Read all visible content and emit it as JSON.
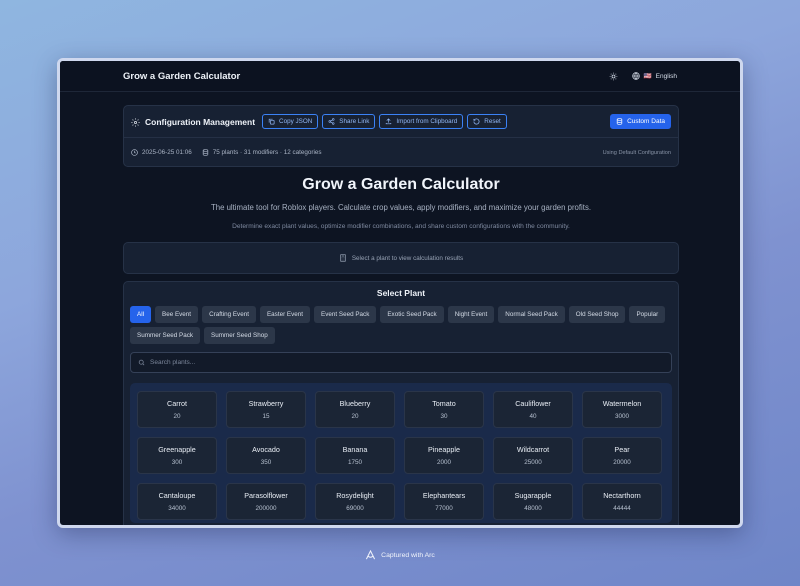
{
  "header": {
    "title": "Grow a Garden Calculator",
    "language_flag": "🇺🇸",
    "language": "English",
    "icons": {
      "theme": "sun-icon",
      "language": "globe-icon"
    }
  },
  "config": {
    "title": "Configuration Management",
    "buttons": {
      "copy_json": "Copy JSON",
      "share_link": "Share Link",
      "import_clipboard": "Import from Clipboard",
      "reset": "Reset",
      "custom_data": "Custom Data"
    },
    "timestamp": "2025-06-25 01:06",
    "summary": "75 plants · 31 modifiers · 12 categories",
    "status": "Using Default Configuration"
  },
  "hero": {
    "title": "Grow a Garden Calculator",
    "subtitle": "The ultimate tool for Roblox players. Calculate crop values, apply modifiers, and maximize your garden profits.",
    "description": "Determine exact plant values, optimize modifier combinations, and share custom configurations with the community."
  },
  "result": {
    "placeholder": "Select a plant to view calculation results"
  },
  "select": {
    "title": "Select Plant",
    "filters": [
      "All",
      "Bee Event",
      "Crafting Event",
      "Easter Event",
      "Event Seed Pack",
      "Exotic Seed Pack",
      "Night Event",
      "Normal Seed Pack",
      "Old Seed Shop",
      "Popular",
      "Summer Seed Pack",
      "Summer Seed Shop"
    ],
    "active_filter": "All",
    "search_placeholder": "Search plants...",
    "plants": [
      {
        "name": "Carrot",
        "value": "20"
      },
      {
        "name": "Strawberry",
        "value": "15"
      },
      {
        "name": "Blueberry",
        "value": "20"
      },
      {
        "name": "Tomato",
        "value": "30"
      },
      {
        "name": "Cauliflower",
        "value": "40"
      },
      {
        "name": "Watermelon",
        "value": "3000"
      },
      {
        "name": "Greenapple",
        "value": "300"
      },
      {
        "name": "Avocado",
        "value": "350"
      },
      {
        "name": "Banana",
        "value": "1750"
      },
      {
        "name": "Pineapple",
        "value": "2000"
      },
      {
        "name": "Wildcarrot",
        "value": "25000"
      },
      {
        "name": "Pear",
        "value": "20000"
      },
      {
        "name": "Cantaloupe",
        "value": "34000"
      },
      {
        "name": "Parasolflower",
        "value": "200000"
      },
      {
        "name": "Rosydelight",
        "value": "69000"
      },
      {
        "name": "Elephantears",
        "value": "77000"
      },
      {
        "name": "Sugarapple",
        "value": "48000"
      },
      {
        "name": "Nectarthorn",
        "value": "44444"
      }
    ]
  },
  "footer": {
    "captured": "Captured with Arc"
  },
  "colors": {
    "accent": "#2563eb",
    "background": "#0d1422",
    "panel": "#172133"
  }
}
